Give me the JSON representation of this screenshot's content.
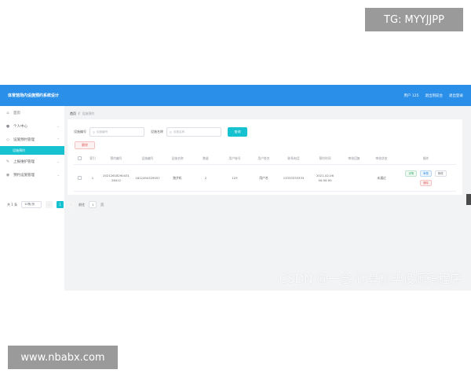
{
  "overlays": {
    "tg_badge": "TG: MYYJJPP",
    "watermark_site": "www.nbabx.com",
    "csdn_watermark": "CSDN @一念 计算机毕设源码程序"
  },
  "header": {
    "title": "体育馆场内设施预约系统设计",
    "links": [
      "用户 125",
      "退出到前台",
      "退出登录"
    ]
  },
  "sidebar": {
    "items": [
      {
        "icon": "home-icon",
        "label": "首页"
      },
      {
        "icon": "user-icon",
        "label": "个人中心"
      },
      {
        "icon": "tag-icon",
        "label": "设施预约管理"
      },
      {
        "icon": "sub",
        "label": "设施预约"
      },
      {
        "icon": "wrench-icon",
        "label": "上报维护管理"
      },
      {
        "icon": "pin-icon",
        "label": "预约设施管理"
      }
    ]
  },
  "breadcrumb": {
    "home": "首页",
    "separator": "/",
    "current": "设施预约"
  },
  "search": {
    "field1_label": "设施编号",
    "field1_placeholder": "设施编号",
    "field2_label": "设施名称",
    "field2_placeholder": "设施名称",
    "button": "查询"
  },
  "actions": {
    "delete": "删除"
  },
  "table": {
    "columns": [
      "索引",
      "预约编号",
      "设施编号",
      "设施名称",
      "数量",
      "用户账号",
      "用户姓名",
      "联系电话",
      "预约时间",
      "审核回复",
      "审核状态",
      "操作"
    ],
    "rows": [
      {
        "index": "1",
        "booking_no": "2021261829043126412",
        "facility_no": "1612494329057",
        "facility_name": "跑步机",
        "quantity": "2",
        "user_account": "125",
        "user_name": "用户名",
        "phone": "13333333333",
        "time": "2021-02-06 00:00:00",
        "reply": "",
        "status": "未通过",
        "ops": {
          "detail": "详情",
          "review": "审核",
          "edit": "修改",
          "delete": "删除"
        }
      }
    ]
  },
  "pagination": {
    "total": "共 1 条",
    "page_size": "10条/页",
    "prev": "‹",
    "current": "1",
    "next": "›",
    "goto_label": "前往",
    "goto_value": "1",
    "page_unit": "页"
  },
  "colors": {
    "header_blue": "#2a8fe8",
    "accent_teal": "#17c2d0",
    "danger": "#e35d5d"
  }
}
